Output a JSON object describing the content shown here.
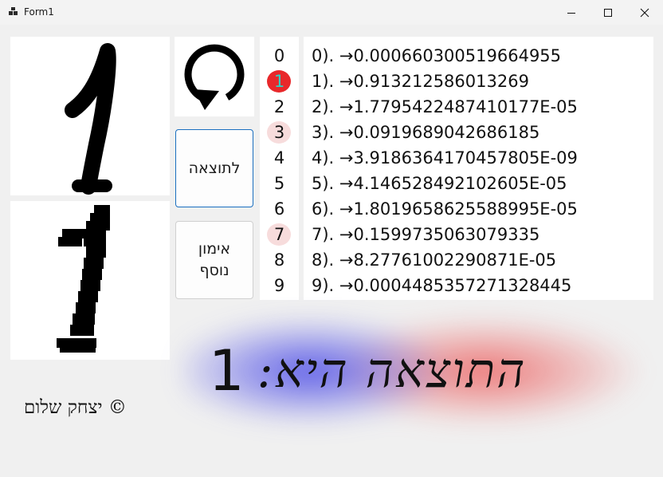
{
  "window": {
    "title": "Form1",
    "app_icon": "winforms-app-icon",
    "controls": {
      "minimize": "minimize-icon",
      "maximize": "maximize-icon",
      "close": "close-icon"
    }
  },
  "input_canvas": {
    "content": "handwritten digit one"
  },
  "preview_canvas": {
    "content": "pixelated downsampled digit one"
  },
  "reset_button": {
    "icon": "rotate-arrow-icon"
  },
  "result_button": {
    "label": "לתוצאה"
  },
  "train_button": {
    "line1": "אימון",
    "line2": "נוסף"
  },
  "digits": [
    {
      "label": "0",
      "highlight": ""
    },
    {
      "label": "1",
      "highlight": "#e8282b",
      "text_color": "#2bd4c8"
    },
    {
      "label": "2",
      "highlight": ""
    },
    {
      "label": "3",
      "highlight": "#f7dcdc"
    },
    {
      "label": "4",
      "highlight": ""
    },
    {
      "label": "5",
      "highlight": ""
    },
    {
      "label": "6",
      "highlight": ""
    },
    {
      "label": "7",
      "highlight": "#f7dcdc"
    },
    {
      "label": "8",
      "highlight": ""
    },
    {
      "label": "9",
      "highlight": ""
    }
  ],
  "probabilities": [
    "0). →0.000660300519664955",
    "1). →0.913212586013269",
    "2). →1.7795422487410177E-05",
    "3). →0.0919689042686185",
    "4). →3.9186364170457805E-09",
    "5). →4.146528492102605E-05",
    "6). →1.8019658625588995E-05",
    "7). →0.1599735063079335",
    "8). →8.27761002290871E-05",
    "9). →0.0004485357271328445"
  ],
  "result": {
    "label": "התוצאה היא:",
    "digit": "1"
  },
  "credit": "© יצחק שלום",
  "colors": {
    "form_bg": "#f0f0f0",
    "panel_bg": "#ffffff",
    "accent_border": "#1a6fc0",
    "glow_blue": "#4646e6",
    "glow_red": "#eb5050"
  }
}
